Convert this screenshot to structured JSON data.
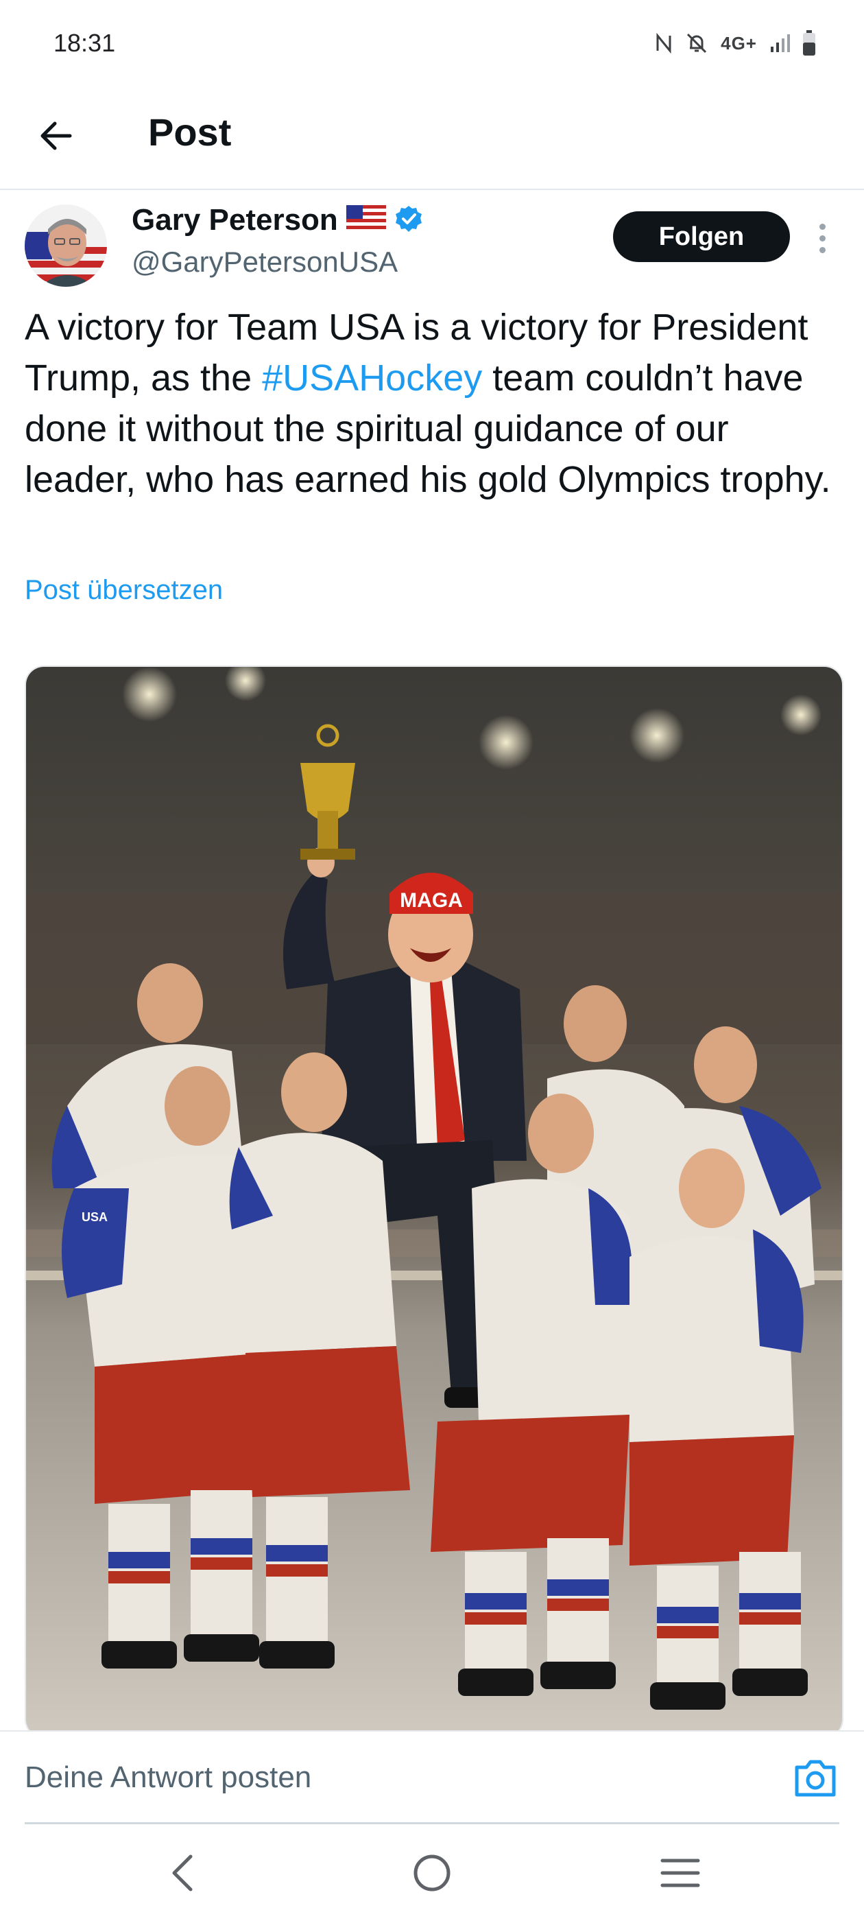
{
  "status_bar": {
    "time": "18:31",
    "network": "4G+",
    "icons": [
      "nfc-icon",
      "notifications-off-icon",
      "signal-icon",
      "battery-icon"
    ]
  },
  "header": {
    "title": "Post",
    "back_icon": "arrow-left-icon"
  },
  "tweet": {
    "author_name": "Gary Peterson",
    "author_flag": "🇺🇸",
    "handle": "@GaryPetersonUSA",
    "follow_label": "Folgen",
    "text_before": "A victory for Team USA is a victory for President Trump, as the ",
    "hashtag": "#USAHockey",
    "text_after": " team couldn’t have done it without the spiritual guidance of our leader, who has earned his gold Olympics trophy.",
    "translate_label": "Post übersetzen",
    "media_labels": {
      "cap": "MAGA",
      "patch": "USA"
    }
  },
  "reply": {
    "placeholder": "Deine Antwort posten"
  },
  "colors": {
    "accent": "#1d9bf0",
    "text": "#0f1419",
    "secondary": "#536471",
    "follow_bg": "#0f1419"
  }
}
